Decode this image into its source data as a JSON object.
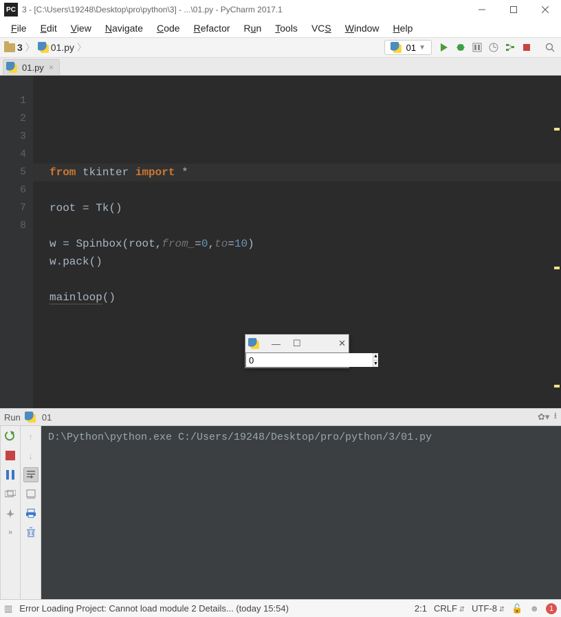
{
  "titlebar": {
    "app_badge": "PC",
    "text": "3 - [C:\\Users\\19248\\Desktop\\pro\\python\\3] - ...\\01.py - PyCharm 2017.1"
  },
  "menu": {
    "items": [
      {
        "pre": "",
        "ul": "F",
        "post": "ile"
      },
      {
        "pre": "",
        "ul": "E",
        "post": "dit"
      },
      {
        "pre": "",
        "ul": "V",
        "post": "iew"
      },
      {
        "pre": "",
        "ul": "N",
        "post": "avigate"
      },
      {
        "pre": "",
        "ul": "C",
        "post": "ode"
      },
      {
        "pre": "",
        "ul": "R",
        "post": "efactor"
      },
      {
        "pre": "R",
        "ul": "u",
        "post": "n"
      },
      {
        "pre": "",
        "ul": "T",
        "post": "ools"
      },
      {
        "pre": "VC",
        "ul": "S",
        "post": ""
      },
      {
        "pre": "",
        "ul": "W",
        "post": "indow"
      },
      {
        "pre": "",
        "ul": "H",
        "post": "elp"
      }
    ]
  },
  "breadcrumb": {
    "project": "3",
    "file": "01.py"
  },
  "run_config": {
    "label": "01"
  },
  "tab": {
    "label": "01.py"
  },
  "editor": {
    "line_count": 8,
    "tokens": {
      "from": "from",
      "tkinter": "tkinter",
      "import": "import",
      "star": "*",
      "root": "root",
      "Tk": "Tk",
      "w": "w",
      "Spinbox": "Spinbox",
      "from_": "from_",
      "to": "to",
      "zero": "0",
      "ten": "10",
      "pack": "w.pack",
      "mainloop": "mainloop",
      "comma": ",",
      "eq": "=",
      "lp": "(",
      "rp": ")"
    }
  },
  "tk_window": {
    "value": "0"
  },
  "run_panel": {
    "header_label": "Run",
    "header_config": "01",
    "command": "D:\\Python\\python.exe C:/Users/19248/Desktop/pro/python/3/01.py"
  },
  "statusbar": {
    "error": "Error Loading Project: Cannot load module 2 Details... (today 15:54)",
    "caret": "2:1",
    "line_sep": "CRLF",
    "encoding": "UTF-8",
    "problems": "1"
  }
}
